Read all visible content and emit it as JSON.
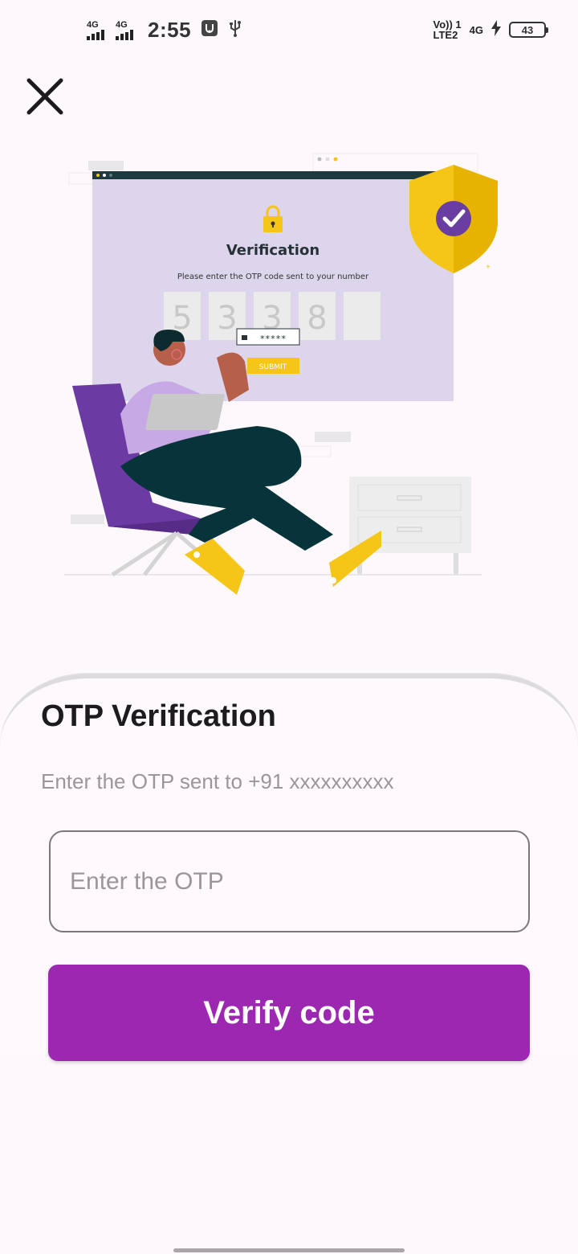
{
  "status_bar": {
    "sim1_net": "4G",
    "sim2_net": "4G",
    "time": "2:55",
    "volte_top": "Vo)) 1",
    "volte_bottom": "LTE2",
    "net_right": "4G",
    "battery": "43"
  },
  "illustration": {
    "heading": "Verification",
    "subtext": "Please enter the OTP code sent to your number",
    "digits": [
      "5",
      "3",
      "3",
      "8",
      ""
    ],
    "password_mask": "*****",
    "submit_label": "SUBMIT"
  },
  "sheet": {
    "title": "OTP Verification",
    "subtitle": "Enter the OTP sent to +91 xxxxxxxxxx",
    "otp_placeholder": "Enter the OTP",
    "otp_value": "",
    "verify_label": "Verify code"
  },
  "colors": {
    "primary": "#9c27b0",
    "background": "#fcf8fc",
    "illustration_panel": "#dcd5eb",
    "accent_yellow": "#f5c518"
  },
  "icons": [
    "close-icon",
    "usb-debug-icon",
    "usb-icon",
    "charging-bolt-icon",
    "lock-icon",
    "shield-check-icon"
  ]
}
